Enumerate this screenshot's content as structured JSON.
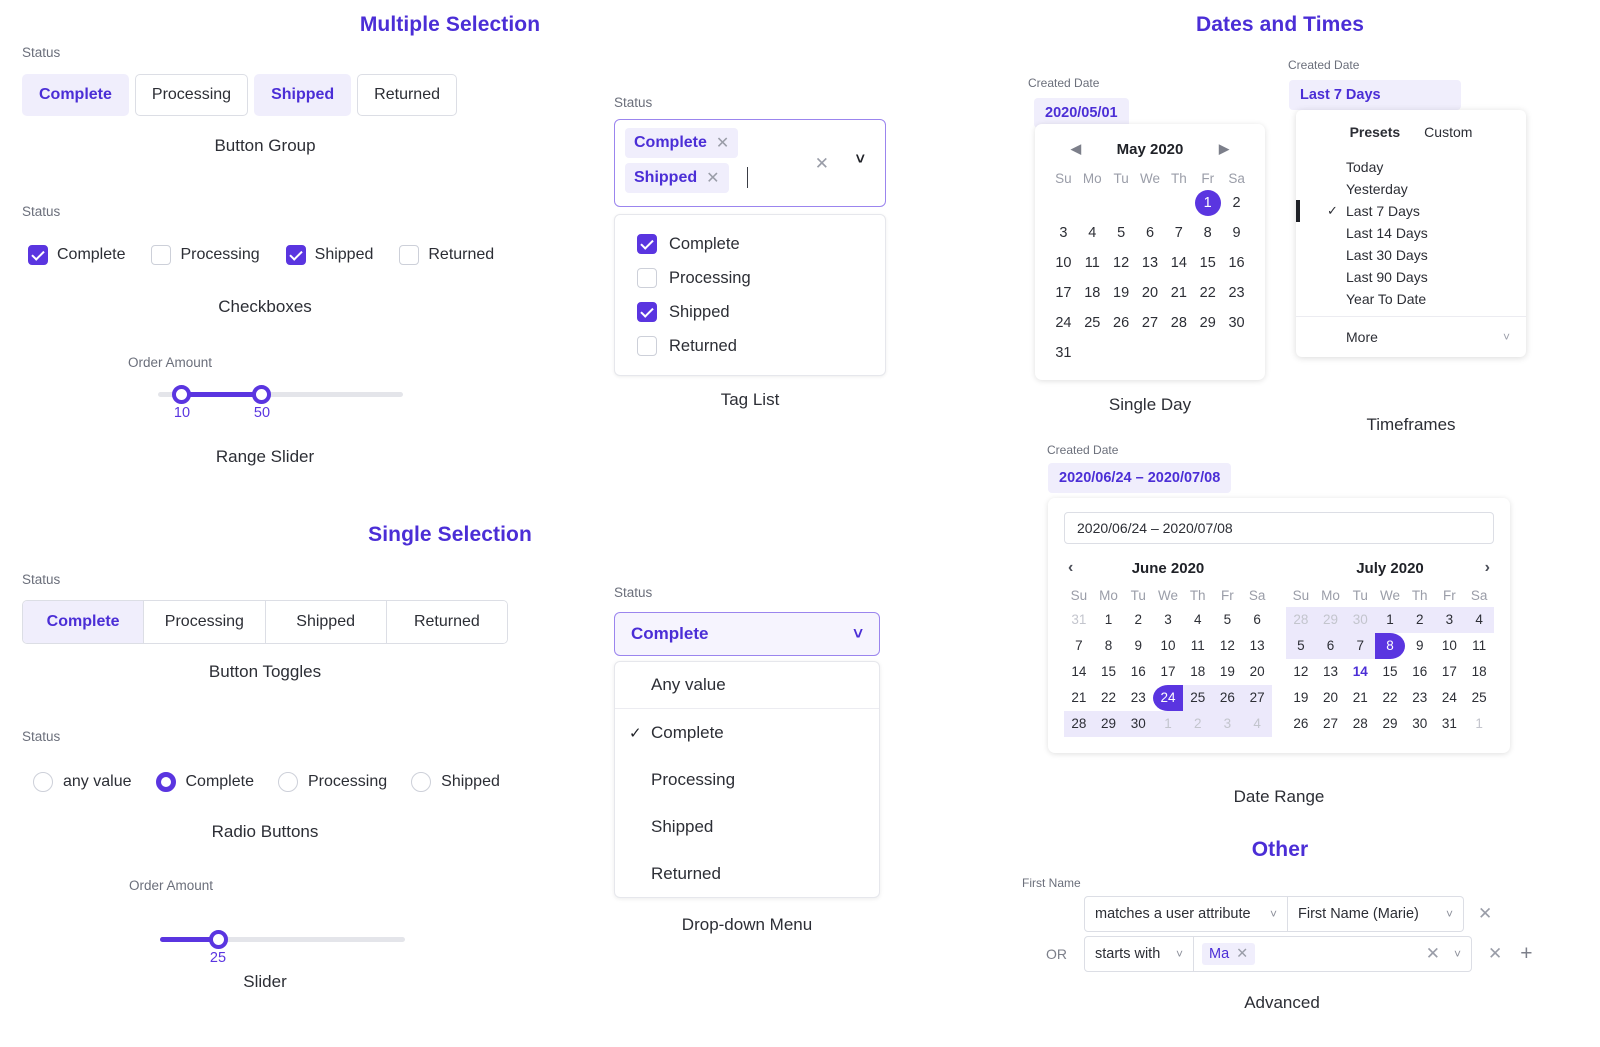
{
  "sections": {
    "multiple_selection": "Multiple Selection",
    "single_selection": "Single Selection",
    "dates_and_times": "Dates and Times",
    "other": "Other"
  },
  "labels": {
    "status": "Status",
    "order_amount": "Order Amount",
    "created_date": "Created Date",
    "first_name": "First Name",
    "or": "OR"
  },
  "captions": {
    "button_group": "Button Group",
    "checkboxes": "Checkboxes",
    "range_slider": "Range Slider",
    "tag_list": "Tag List",
    "button_toggles": "Button Toggles",
    "radio_buttons": "Radio Buttons",
    "slider": "Slider",
    "dropdown_menu": "Drop-down Menu",
    "single_day": "Single Day",
    "timeframes": "Timeframes",
    "date_range": "Date Range",
    "advanced": "Advanced"
  },
  "button_group": {
    "options": [
      {
        "label": "Complete",
        "selected": true
      },
      {
        "label": "Processing",
        "selected": false
      },
      {
        "label": "Shipped",
        "selected": true
      },
      {
        "label": "Returned",
        "selected": false
      }
    ]
  },
  "checkboxes": {
    "options": [
      {
        "label": "Complete",
        "checked": true
      },
      {
        "label": "Processing",
        "checked": false
      },
      {
        "label": "Shipped",
        "checked": true
      },
      {
        "label": "Returned",
        "checked": false
      }
    ]
  },
  "range_slider": {
    "min_value": "10",
    "max_value": "50"
  },
  "tag_list": {
    "tags": [
      "Complete",
      "Shipped"
    ],
    "options": [
      {
        "label": "Complete",
        "checked": true
      },
      {
        "label": "Processing",
        "checked": false
      },
      {
        "label": "Shipped",
        "checked": true
      },
      {
        "label": "Returned",
        "checked": false
      }
    ]
  },
  "button_toggles": {
    "options": [
      {
        "label": "Complete",
        "selected": true
      },
      {
        "label": "Processing",
        "selected": false
      },
      {
        "label": "Shipped",
        "selected": false
      },
      {
        "label": "Returned",
        "selected": false
      }
    ]
  },
  "radio_buttons": {
    "options": [
      {
        "label": "any value",
        "selected": false
      },
      {
        "label": "Complete",
        "selected": true
      },
      {
        "label": "Processing",
        "selected": false
      },
      {
        "label": "Shipped",
        "selected": false
      }
    ]
  },
  "slider": {
    "value": "25"
  },
  "dropdown": {
    "selected": "Complete",
    "options": [
      {
        "label": "Any value",
        "checked": false
      },
      {
        "label": "Complete",
        "checked": true
      },
      {
        "label": "Processing",
        "checked": false
      },
      {
        "label": "Shipped",
        "checked": false
      },
      {
        "label": "Returned",
        "checked": false
      }
    ]
  },
  "single_day": {
    "chip": "2020/05/01",
    "month_title": "May 2020",
    "dow": [
      "Su",
      "Mo",
      "Tu",
      "We",
      "Th",
      "Fr",
      "Sa"
    ],
    "selected_day": 1,
    "weeks": [
      [
        "",
        "",
        "",
        "",
        "",
        "1",
        "2"
      ],
      [
        "3",
        "4",
        "5",
        "6",
        "7",
        "8",
        "9"
      ],
      [
        "10",
        "11",
        "12",
        "13",
        "14",
        "15",
        "16"
      ],
      [
        "17",
        "18",
        "19",
        "20",
        "21",
        "22",
        "23"
      ],
      [
        "24",
        "25",
        "26",
        "27",
        "28",
        "29",
        "30"
      ],
      [
        "31",
        "",
        "",
        "",
        "",
        "",
        ""
      ]
    ]
  },
  "timeframes": {
    "chip": "Last 7 Days",
    "tabs": [
      {
        "label": "Presets",
        "active": true
      },
      {
        "label": "Custom",
        "active": false
      }
    ],
    "presets": [
      {
        "label": "Today",
        "selected": false
      },
      {
        "label": "Yesterday",
        "selected": false
      },
      {
        "label": "Last 7 Days",
        "selected": true
      },
      {
        "label": "Last 14 Days",
        "selected": false
      },
      {
        "label": "Last 30 Days",
        "selected": false
      },
      {
        "label": "Last 90 Days",
        "selected": false
      },
      {
        "label": "Year To Date",
        "selected": false
      }
    ],
    "more_label": "More"
  },
  "date_range": {
    "chip": "2020/06/24 – 2020/07/08",
    "input_value": "2020/06/24  –  2020/07/08",
    "dow": [
      "Su",
      "Mo",
      "Tu",
      "We",
      "Th",
      "Fr",
      "Sa"
    ],
    "left_month": "June 2020",
    "right_month": "July 2020",
    "left_weeks": [
      [
        {
          "d": "31",
          "s": "muted"
        },
        {
          "d": "1",
          "s": ""
        },
        {
          "d": "2",
          "s": ""
        },
        {
          "d": "3",
          "s": ""
        },
        {
          "d": "4",
          "s": ""
        },
        {
          "d": "5",
          "s": ""
        },
        {
          "d": "6",
          "s": ""
        }
      ],
      [
        {
          "d": "7",
          "s": ""
        },
        {
          "d": "8",
          "s": ""
        },
        {
          "d": "9",
          "s": ""
        },
        {
          "d": "10",
          "s": ""
        },
        {
          "d": "11",
          "s": ""
        },
        {
          "d": "12",
          "s": ""
        },
        {
          "d": "13",
          "s": ""
        }
      ],
      [
        {
          "d": "14",
          "s": ""
        },
        {
          "d": "15",
          "s": ""
        },
        {
          "d": "16",
          "s": ""
        },
        {
          "d": "17",
          "s": ""
        },
        {
          "d": "18",
          "s": ""
        },
        {
          "d": "19",
          "s": ""
        },
        {
          "d": "20",
          "s": ""
        }
      ],
      [
        {
          "d": "21",
          "s": ""
        },
        {
          "d": "22",
          "s": ""
        },
        {
          "d": "23",
          "s": ""
        },
        {
          "d": "24",
          "s": "start"
        },
        {
          "d": "25",
          "s": "inrange"
        },
        {
          "d": "26",
          "s": "inrange"
        },
        {
          "d": "27",
          "s": "inrange"
        }
      ],
      [
        {
          "d": "28",
          "s": "inrange"
        },
        {
          "d": "29",
          "s": "inrange"
        },
        {
          "d": "30",
          "s": "inrange"
        },
        {
          "d": "1",
          "s": "inrange muted"
        },
        {
          "d": "2",
          "s": "inrange muted"
        },
        {
          "d": "3",
          "s": "inrange muted"
        },
        {
          "d": "4",
          "s": "inrange muted"
        }
      ]
    ],
    "right_weeks": [
      [
        {
          "d": "28",
          "s": "inrange muted"
        },
        {
          "d": "29",
          "s": "inrange muted"
        },
        {
          "d": "30",
          "s": "inrange muted"
        },
        {
          "d": "1",
          "s": "inrange"
        },
        {
          "d": "2",
          "s": "inrange"
        },
        {
          "d": "3",
          "s": "inrange"
        },
        {
          "d": "4",
          "s": "inrange"
        }
      ],
      [
        {
          "d": "5",
          "s": "inrange"
        },
        {
          "d": "6",
          "s": "inrange"
        },
        {
          "d": "7",
          "s": "inrange"
        },
        {
          "d": "8",
          "s": "end"
        },
        {
          "d": "9",
          "s": ""
        },
        {
          "d": "10",
          "s": ""
        },
        {
          "d": "11",
          "s": ""
        }
      ],
      [
        {
          "d": "12",
          "s": ""
        },
        {
          "d": "13",
          "s": ""
        },
        {
          "d": "14",
          "s": "today"
        },
        {
          "d": "15",
          "s": ""
        },
        {
          "d": "16",
          "s": ""
        },
        {
          "d": "17",
          "s": ""
        },
        {
          "d": "18",
          "s": ""
        }
      ],
      [
        {
          "d": "19",
          "s": ""
        },
        {
          "d": "20",
          "s": ""
        },
        {
          "d": "21",
          "s": ""
        },
        {
          "d": "22",
          "s": ""
        },
        {
          "d": "23",
          "s": ""
        },
        {
          "d": "24",
          "s": ""
        },
        {
          "d": "25",
          "s": ""
        }
      ],
      [
        {
          "d": "26",
          "s": ""
        },
        {
          "d": "27",
          "s": ""
        },
        {
          "d": "28",
          "s": ""
        },
        {
          "d": "29",
          "s": ""
        },
        {
          "d": "30",
          "s": ""
        },
        {
          "d": "31",
          "s": ""
        },
        {
          "d": "1",
          "s": "muted"
        }
      ]
    ]
  },
  "advanced": {
    "row1": {
      "operator": "matches a user attribute",
      "value": "First Name (Marie)"
    },
    "row2": {
      "conjunction": "OR",
      "operator": "starts with",
      "tag": "Ma"
    }
  },
  "colors": {
    "accent": "#5a35e0",
    "accent_text": "#4b2ed6",
    "accent_soft": "#f0eefc",
    "range_fill": "#ece9fb",
    "border": "#dcdee5",
    "muted_text": "#9a9da8"
  }
}
